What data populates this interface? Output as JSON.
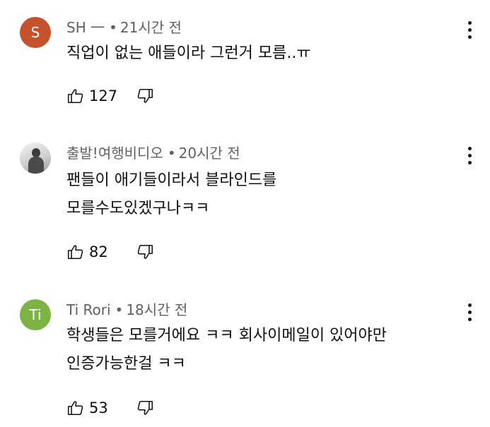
{
  "comments": [
    {
      "author": "SH 一",
      "time": "21시간 전",
      "avatar_letter": "S",
      "avatar_color": "#c5522c",
      "text_lines": [
        "직업이 없는 애들이라 그런거 모름..ㅠ"
      ],
      "likes": "127"
    },
    {
      "author": "출발!여행비디오",
      "time": "20시간 전",
      "avatar_letter": "",
      "avatar_color": "#cccccc",
      "text_lines": [
        "팬들이 애기들이라서 블라인드를",
        "모를수도있겠구나ㅋㅋ"
      ],
      "likes": "82"
    },
    {
      "author": "Ti Rori",
      "time": "18시간 전",
      "avatar_letter": "Ti",
      "avatar_color": "#7cb342",
      "text_lines": [
        "학생들은 모를거에요 ㅋㅋ 회사이메일이 있어야만",
        "인증가능한걸 ㅋㅋ"
      ],
      "likes": "53"
    }
  ],
  "meta_separator": "•",
  "icons": {
    "like": "thumb-up-icon",
    "dislike": "thumb-down-icon",
    "more": "more-vertical-icon"
  }
}
